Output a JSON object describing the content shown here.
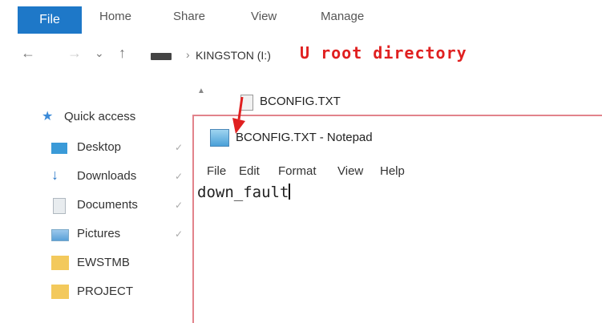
{
  "ribbon": {
    "tabs": [
      "File",
      "Home",
      "Share",
      "View",
      "Manage"
    ]
  },
  "address": {
    "back": "←",
    "forward": "→",
    "recent": "⌄",
    "up": "↑",
    "crumb_arrow": "›",
    "path": "KINGSTON (I:)",
    "annotation": "U root directory"
  },
  "sidebar": {
    "items": [
      {
        "label": "Quick access",
        "icon": "star-icon",
        "color": "#3a8ad8"
      },
      {
        "label": "Desktop",
        "icon": "desktop-icon",
        "color": "#3a9ad8"
      },
      {
        "label": "Downloads",
        "icon": "download-icon",
        "color": "#2a78c8"
      },
      {
        "label": "Documents",
        "icon": "document-icon",
        "color": "#b0b8c0"
      },
      {
        "label": "Pictures",
        "icon": "pictures-icon",
        "color": "#5aa0d8"
      },
      {
        "label": "EWSTMB",
        "icon": "folder-icon",
        "color": "#f3c95c"
      },
      {
        "label": "PROJECT",
        "icon": "folder-icon",
        "color": "#f3c95c"
      }
    ],
    "pin": "✓"
  },
  "files": [
    {
      "name": "BCONFIG.TXT"
    }
  ],
  "notepad": {
    "title": "BCONFIG.TXT - Notepad",
    "menu": [
      "File",
      "Edit",
      "Format",
      "View",
      "Help"
    ],
    "content": "down_fault"
  },
  "colors": {
    "accent": "#1e78c8",
    "annotation": "#e02020",
    "window_border": "#e2838b"
  }
}
